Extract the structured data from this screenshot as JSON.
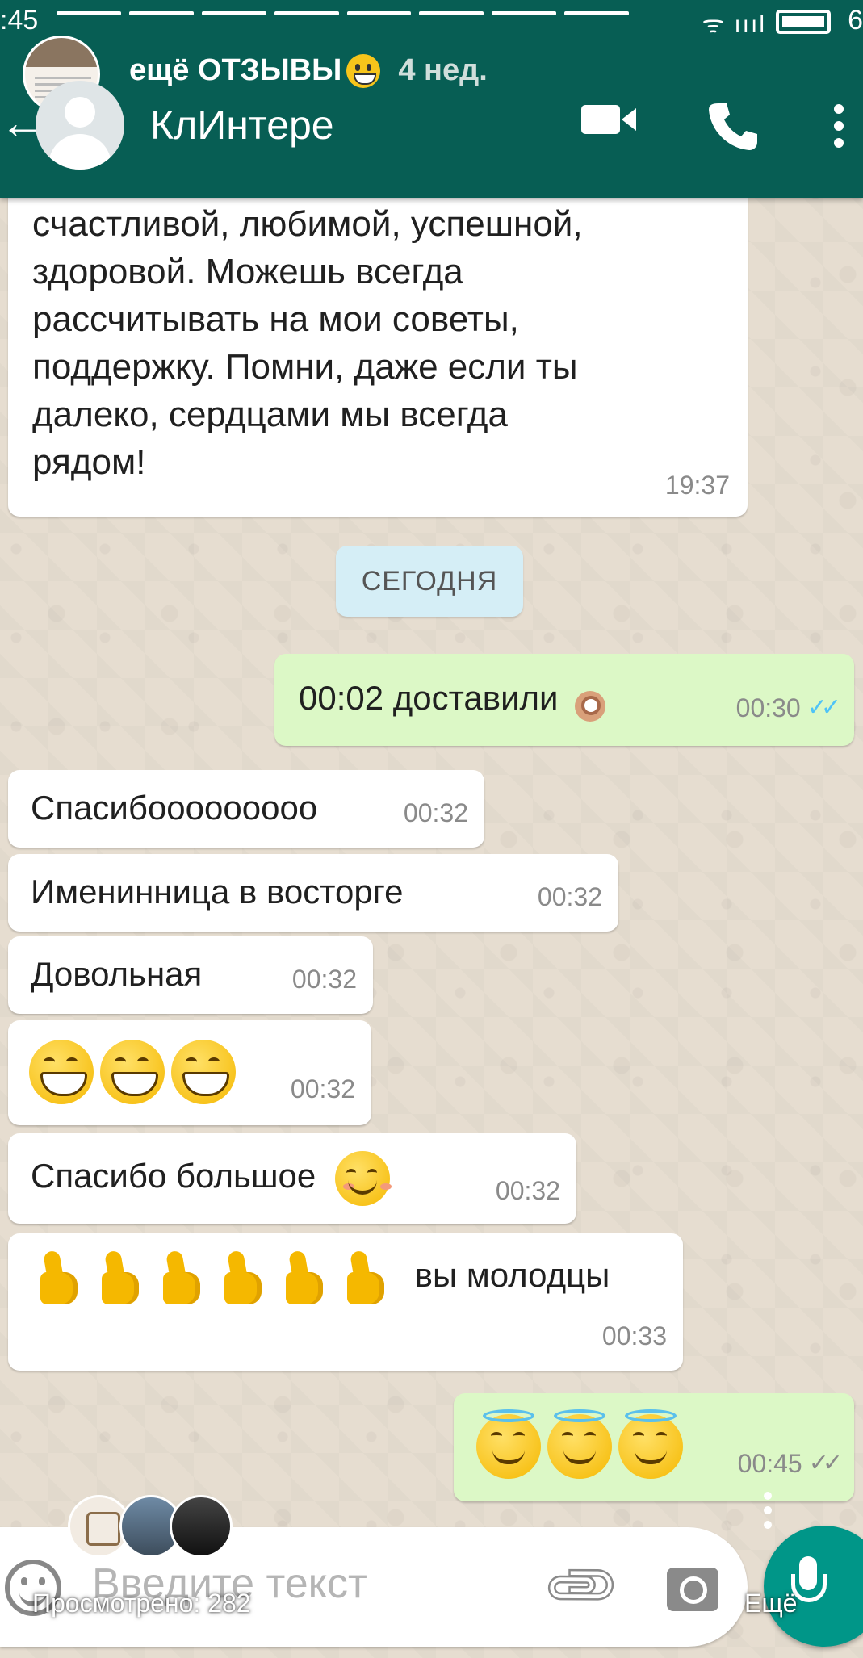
{
  "status_bar": {
    "time": ":45",
    "signal": "ᯤ ıııl",
    "battery": "6"
  },
  "story": {
    "title": "ещё ОТЗЫВЫ",
    "age": "4 нед."
  },
  "chat_header": {
    "contact_name": "КлИнтере"
  },
  "messages": {
    "long": {
      "lines": [
        "счастливой, любимой, успешной,",
        "здоровой. Можешь всегда",
        "рассчитывать на мои советы,",
        "поддержку. Помни, даже если ты",
        "далеко, сердцами мы всегда",
        "рядом!"
      ],
      "time": "19:37"
    },
    "date_divider": "СЕГОДНЯ",
    "out1": {
      "text": "00:02 доставили",
      "time": "00:30"
    },
    "in1": {
      "text": "Спасибооооооооо",
      "time": "00:32"
    },
    "in2": {
      "text": "Именинница в восторге",
      "time": "00:32"
    },
    "in3": {
      "text": "Довольная",
      "time": "00:32"
    },
    "in4": {
      "time": "00:32"
    },
    "in5": {
      "text": "Спасибо большое",
      "time": "00:32"
    },
    "in6": {
      "text": "вы молодцы",
      "time": "00:33"
    },
    "out2": {
      "time": "00:45"
    }
  },
  "input": {
    "placeholder": "Введите текст"
  },
  "story_footer": {
    "views": "Просмотрено: 282",
    "more": "Ещё"
  },
  "colors": {
    "header": "#075e54",
    "outgoing": "#dcf8c6",
    "incoming": "#ffffff",
    "fab": "#009688",
    "read_ticks": "#4fc3f7"
  }
}
